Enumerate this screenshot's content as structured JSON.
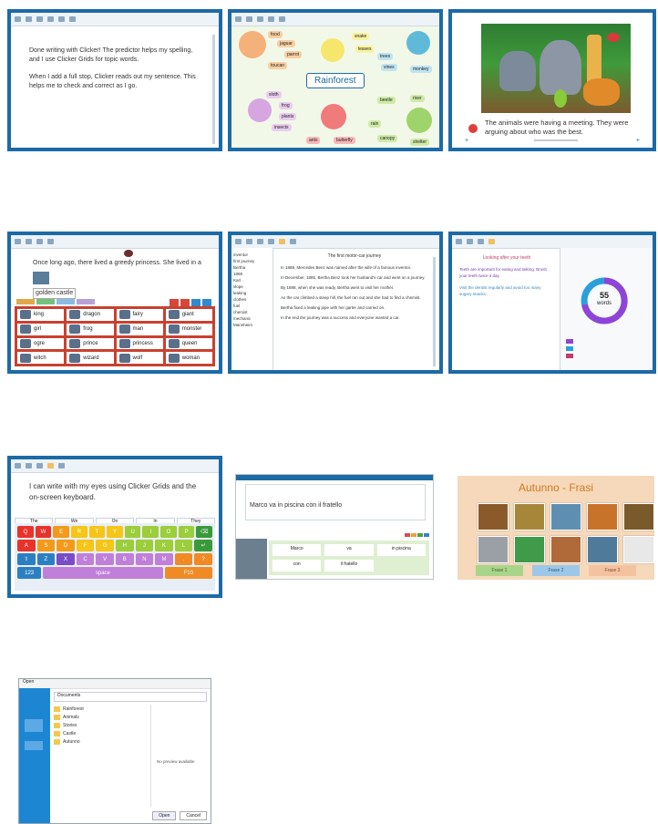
{
  "thumb1": {
    "para1": "Done writing with Clicker! The predictor helps my spelling, and I use Clicker Grids for topic words.",
    "para2": "When I add a full stop, Clicker reads out my sentence. This helps me to check and correct as I go."
  },
  "thumb2": {
    "center": "Rainforest",
    "labels": [
      "food",
      "jaguar",
      "parrot",
      "toucan",
      "snake",
      "leaves",
      "trees",
      "vines",
      "monkey",
      "sloth",
      "frog",
      "plants",
      "insects",
      "ants",
      "butterfly",
      "beetle",
      "river",
      "rain",
      "canopy",
      "shelter"
    ]
  },
  "thumb3": {
    "caption": "The animals were having a meeting. They were arguing about who was the best."
  },
  "thumb4": {
    "sentence": "Once long ago, there lived a greedy princess. She lived in a",
    "typed": "golden castle",
    "words": [
      "king",
      "dragon",
      "fairy",
      "giant",
      "girl",
      "frog",
      "man",
      "monster",
      "ogre",
      "prince",
      "princess",
      "queen",
      "witch",
      "wizard",
      "wolf",
      "woman"
    ]
  },
  "thumb5": {
    "title": "The first motor-car journey",
    "sidebar": [
      "inventor",
      "first journey",
      "Bertha",
      "1888",
      "Karl",
      "slope",
      "leaking",
      "clothes",
      "fuel",
      "chemist",
      "mechanic",
      "Mannheim"
    ],
    "lines": [
      "In 1888, Mercedes Benz was named after the wife of a famous inventor.",
      "In December, 1885, Bertha Benz took her husband's car and went on a journey.",
      "By 1888, when she was ready, Bertha went to visit her mother.",
      "As the car climbed a steep hill, the fuel ran out and she had to find a chemist.",
      "Bertha fixed a leaking pipe with her garter and carried on.",
      "In the end the journey was a success and everyone wanted a car."
    ]
  },
  "thumb6": {
    "heading": "Looking after your teeth",
    "text1": "Teeth are important for eating and talking. Brush your teeth twice a day.",
    "text2": "Visit the dentist regularly and avoid too many sugary snacks.",
    "count": "55",
    "unit": "words"
  },
  "thumb7": {
    "text": "I can write with my eyes using Clicker Grids and the on-screen keyboard.",
    "predict": [
      "The",
      "We",
      "On",
      "In",
      "They"
    ],
    "rows": [
      [
        "Q",
        "W",
        "E",
        "R",
        "T",
        "Y",
        "U",
        "I",
        "O",
        "P",
        "⌫"
      ],
      [
        "A",
        "S",
        "D",
        "F",
        "G",
        "H",
        "J",
        "K",
        "L",
        "↵"
      ],
      [
        "⇧",
        "Z",
        "X",
        "C",
        "V",
        "B",
        "N",
        "M",
        ".",
        "?"
      ],
      [
        "123",
        "space",
        "F10"
      ]
    ]
  },
  "thumb8": {
    "text": "Marco va in piscina con il fratello",
    "words": [
      "Marco",
      "va",
      "in piscina",
      "con",
      "il fratello"
    ]
  },
  "thumb9": {
    "title": "Autunno - Frasi",
    "buttons": [
      "Frase 1",
      "Frase 2",
      "Frase 3"
    ]
  },
  "thumb10": {
    "title": "Open",
    "folder": "Documents",
    "files": [
      "Rainforest",
      "Animals",
      "Stories",
      "Castle",
      "Autunno"
    ],
    "preview": "No preview available",
    "buttons": [
      "Open",
      "Cancel"
    ]
  }
}
